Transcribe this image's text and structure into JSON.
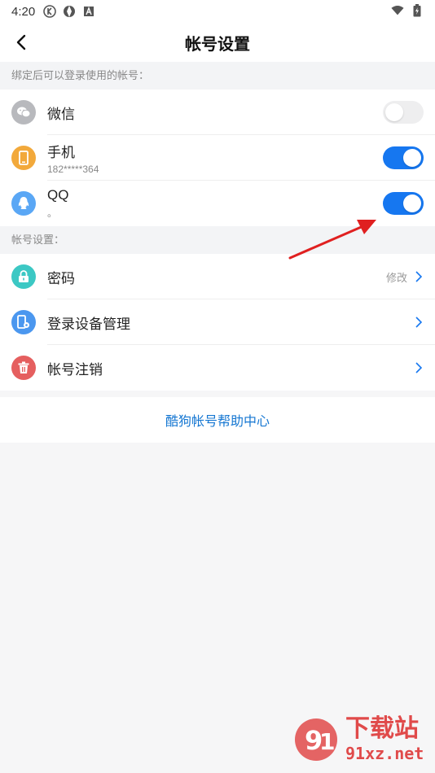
{
  "status_bar": {
    "time": "4:20"
  },
  "nav": {
    "title": "帐号设置"
  },
  "sections": {
    "bind_label": "绑定后可以登录使用的帐号：",
    "account_label": "帐号设置："
  },
  "bind_items": [
    {
      "label": "微信",
      "sub": "",
      "toggle": "off"
    },
    {
      "label": "手机",
      "sub": "182*****364",
      "toggle": "on"
    },
    {
      "label": "QQ",
      "sub": "。",
      "toggle": "on"
    }
  ],
  "account_items": [
    {
      "label": "密码",
      "right_text": "修改"
    },
    {
      "label": "登录设备管理",
      "right_text": ""
    },
    {
      "label": "帐号注销",
      "right_text": ""
    }
  ],
  "help": {
    "label": "酷狗帐号帮助中心"
  },
  "watermark": {
    "brand": "下载站",
    "site": "91xz.net"
  },
  "colors": {
    "accent": "#1677f0",
    "link": "#1677d2",
    "wechat_icon": "#b8b9bd",
    "phone_icon": "#f2a93b",
    "qq_icon": "#5aa7f5",
    "password_icon": "#3cc8c4",
    "device_icon": "#4b97ef",
    "cancel_icon": "#e55f5f",
    "annotation_arrow": "#e02020"
  }
}
